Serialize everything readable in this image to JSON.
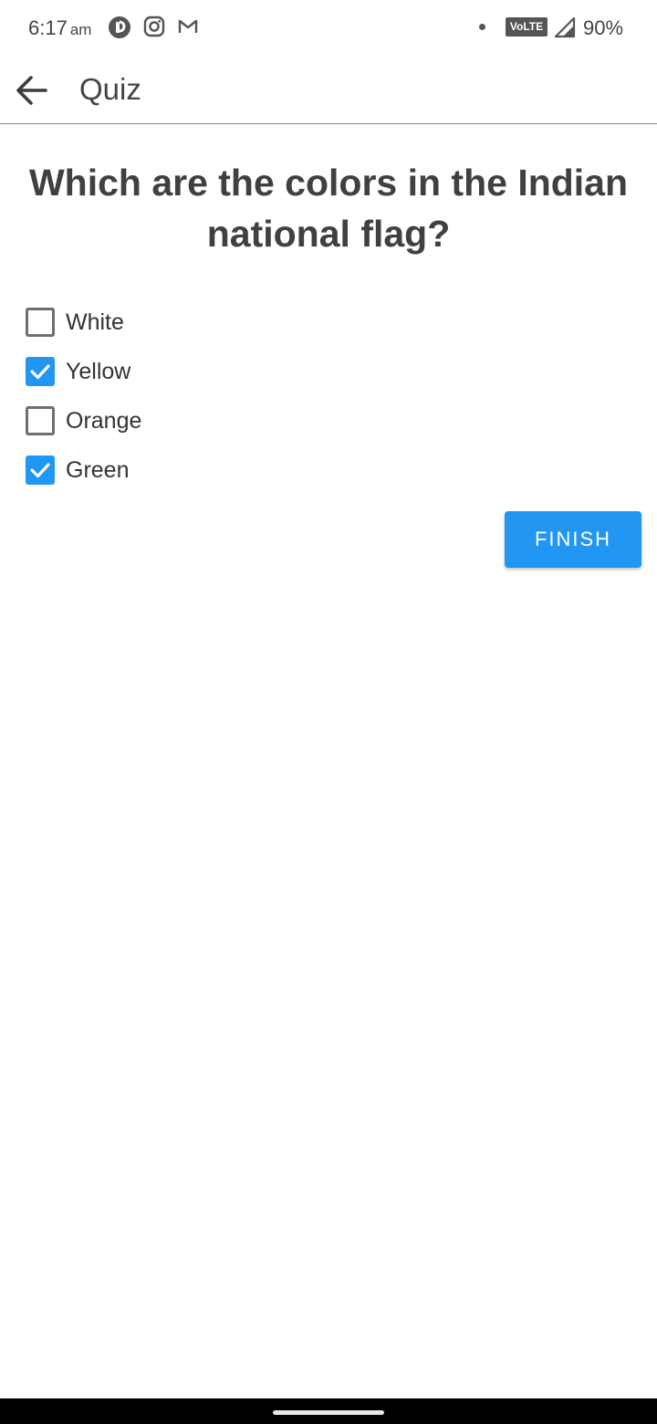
{
  "status_bar": {
    "time": "6:17",
    "ampm": "am",
    "network_badge": "VoLTE",
    "battery": "90%",
    "icons": [
      "app-notification-icon",
      "instagram-icon",
      "gmail-icon",
      "signal-icon"
    ]
  },
  "app_bar": {
    "title": "Quiz"
  },
  "question": "Which are the colors in the Indian national flag?",
  "options": [
    {
      "label": "White",
      "checked": false
    },
    {
      "label": "Yellow",
      "checked": true
    },
    {
      "label": "Orange",
      "checked": false
    },
    {
      "label": "Green",
      "checked": true
    }
  ],
  "finish_label": "FINISH",
  "colors": {
    "accent": "#2196f3",
    "text": "#404040",
    "divider": "#8a8a8a"
  }
}
